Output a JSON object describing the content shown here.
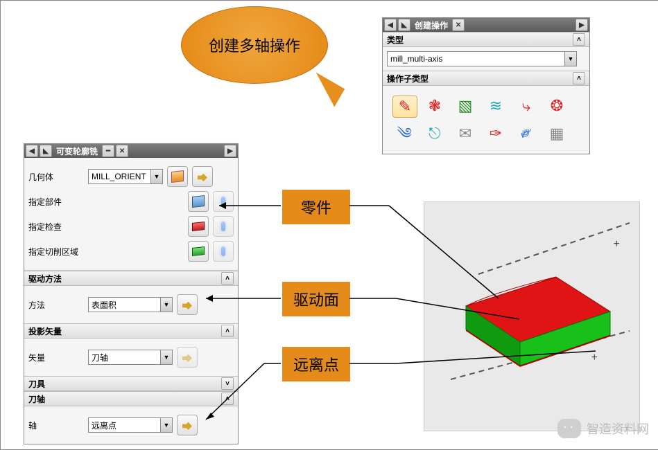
{
  "create_panel": {
    "title": "创建操作",
    "type_header": "类型",
    "type_value": "mill_multi-axis",
    "subtype_header": "操作子类型",
    "op_icons": [
      "variable-contour",
      "variable-profile",
      "sequential-mill",
      "zigzag-surface",
      "tilt-axis",
      "rotary-floor",
      "drive-curve",
      "tool-axis-vector",
      "swarf",
      "deburr",
      "flow-cut",
      "generic-motion"
    ]
  },
  "vc_panel": {
    "title": "可变轮廓铣",
    "geometry_header": "几何体",
    "geometry_label": "几何体",
    "geometry_value": "MILL_ORIENT",
    "specify_part": "指定部件",
    "specify_check": "指定检查",
    "specify_cutarea": "指定切削区域",
    "drive_header": "驱动方法",
    "drive_label": "方法",
    "drive_value": "表面积",
    "proj_header": "投影矢量",
    "proj_label": "矢量",
    "proj_value": "刀轴",
    "tool_header": "刀具",
    "axis_header": "刀轴",
    "axis_label": "轴",
    "axis_value": "远离点"
  },
  "callouts": {
    "bubble": "创建多轴操作",
    "part": "零件",
    "surface": "驱动面",
    "away_point": "远离点"
  },
  "watermark": "智造资料网"
}
